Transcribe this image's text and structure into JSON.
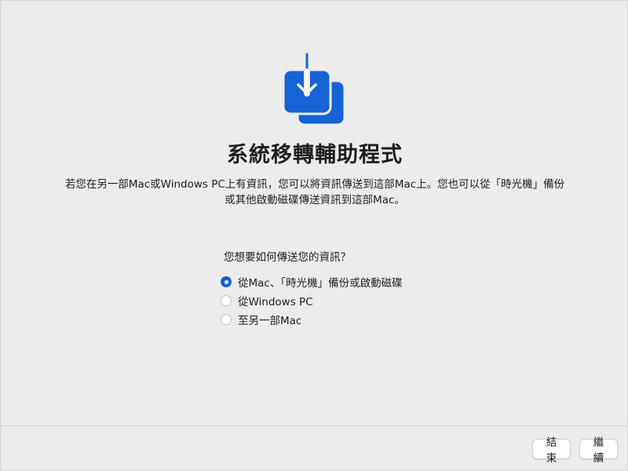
{
  "app": {
    "title": "系統移轉輔助程式",
    "description": "若您在另一部Mac或Windows PC上有資訊，您可以將資訊傳送到這部Mac上。您也可以從「時光機」備份或其他啟動磁碟傳送資訊到這部Mac。",
    "icon": "migration-download-icon",
    "accent_color": "#1563d4"
  },
  "question": "您想要如何傳送您的資訊？",
  "options": [
    {
      "label": "從Mac、「時光機」備份或啟動磁碟",
      "selected": true
    },
    {
      "label": "從Windows PC",
      "selected": false
    },
    {
      "label": "至另一部Mac",
      "selected": false
    }
  ],
  "footer": {
    "quit_label": "結束",
    "continue_label": "繼續"
  }
}
